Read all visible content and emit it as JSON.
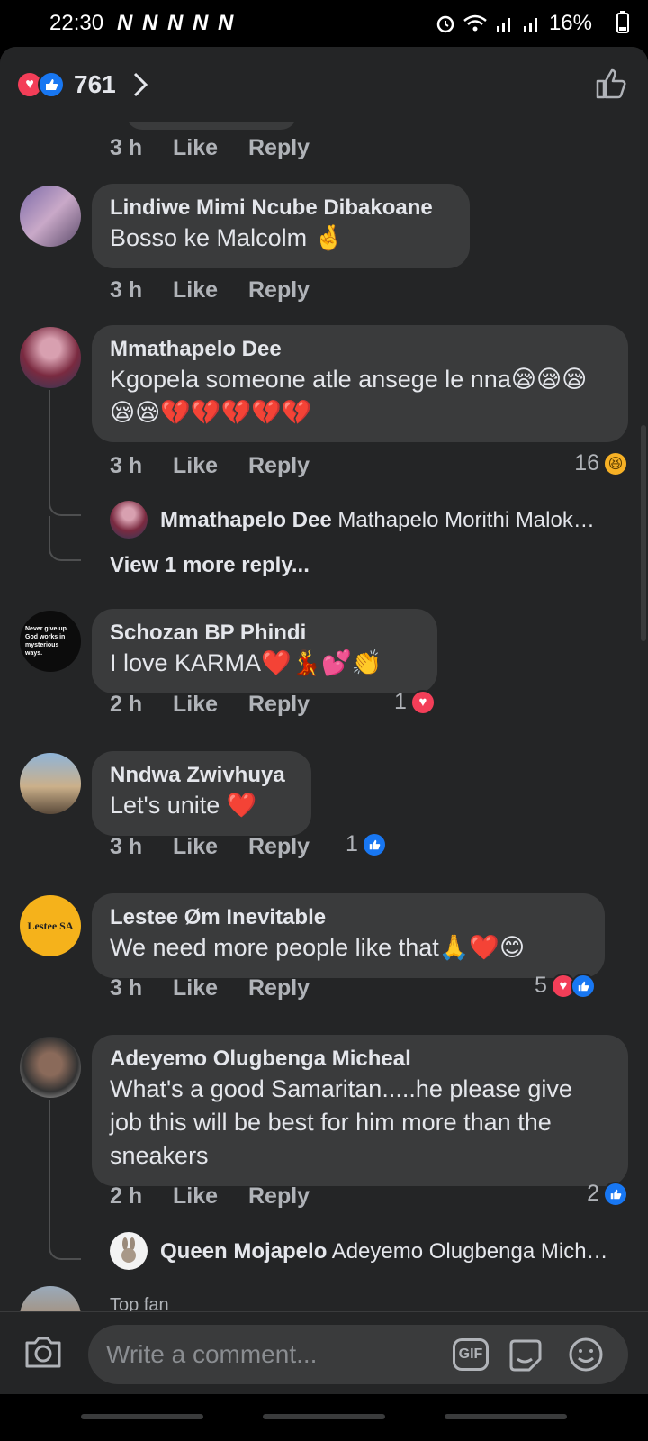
{
  "status_bar": {
    "time": "22:30",
    "notifications": "N N N N N",
    "battery": "16%"
  },
  "header": {
    "reaction_count": "761"
  },
  "colors": {
    "background": "#242526",
    "bubble": "#3a3b3c",
    "love": "#f33e58",
    "like": "#1877f2"
  },
  "top_partial": {
    "time": "3 h",
    "like": "Like",
    "reply": "Reply"
  },
  "comments": [
    {
      "name": "Lindiwe Mimi Ncube Dibakoane",
      "text": "Bosso ke Malcolm 🤞",
      "time": "3 h",
      "like": "Like",
      "reply": "Reply"
    },
    {
      "name": "Mmathapelo Dee",
      "text": "Kgopela someone atle ansege le nna😪😪😪😪😪💔💔💔💔💔",
      "time": "3 h",
      "like": "Like",
      "reply": "Reply",
      "reaction_count": "16",
      "reactions": [
        "haha-icon"
      ],
      "reply_author": "Mmathapelo Dee",
      "reply_text": "Mathapelo Morithi Malok…",
      "view_more": "View 1 more reply..."
    },
    {
      "name": "Schozan BP Phindi",
      "text": "I love KARMA❤️💃💕👏",
      "time": "2 h",
      "like": "Like",
      "reply": "Reply",
      "reaction_count": "1",
      "reactions": [
        "love-icon"
      ],
      "avatar_text": "Never give up. God works in mysterious ways."
    },
    {
      "name": "Nndwa Zwivhuya",
      "text": "Let's unite ❤️",
      "time": "3 h",
      "like": "Like",
      "reply": "Reply",
      "reaction_count": "1",
      "reactions": [
        "like-icon"
      ]
    },
    {
      "name": "Lestee Øm Inevitable",
      "text": "We need more people like that🙏❤️😊",
      "time": "3 h",
      "like": "Like",
      "reply": "Reply",
      "reaction_count": "5",
      "reactions": [
        "love-icon",
        "like-icon"
      ],
      "avatar_text": "Lestee SA"
    },
    {
      "name": "Adeyemo Olugbenga Micheal",
      "text": "What's a good Samaritan.....he please give job this will be best for him more than the sneakers",
      "time": "2 h",
      "like": "Like",
      "reply": "Reply",
      "reaction_count": "2",
      "reactions": [
        "like-icon"
      ],
      "reply_author": "Queen Mojapelo",
      "reply_text": "Adeyemo Olugbenga Mich…"
    }
  ],
  "next_partial": "Top fan",
  "composer": {
    "placeholder": "Write a comment...",
    "gif_label": "GIF"
  }
}
